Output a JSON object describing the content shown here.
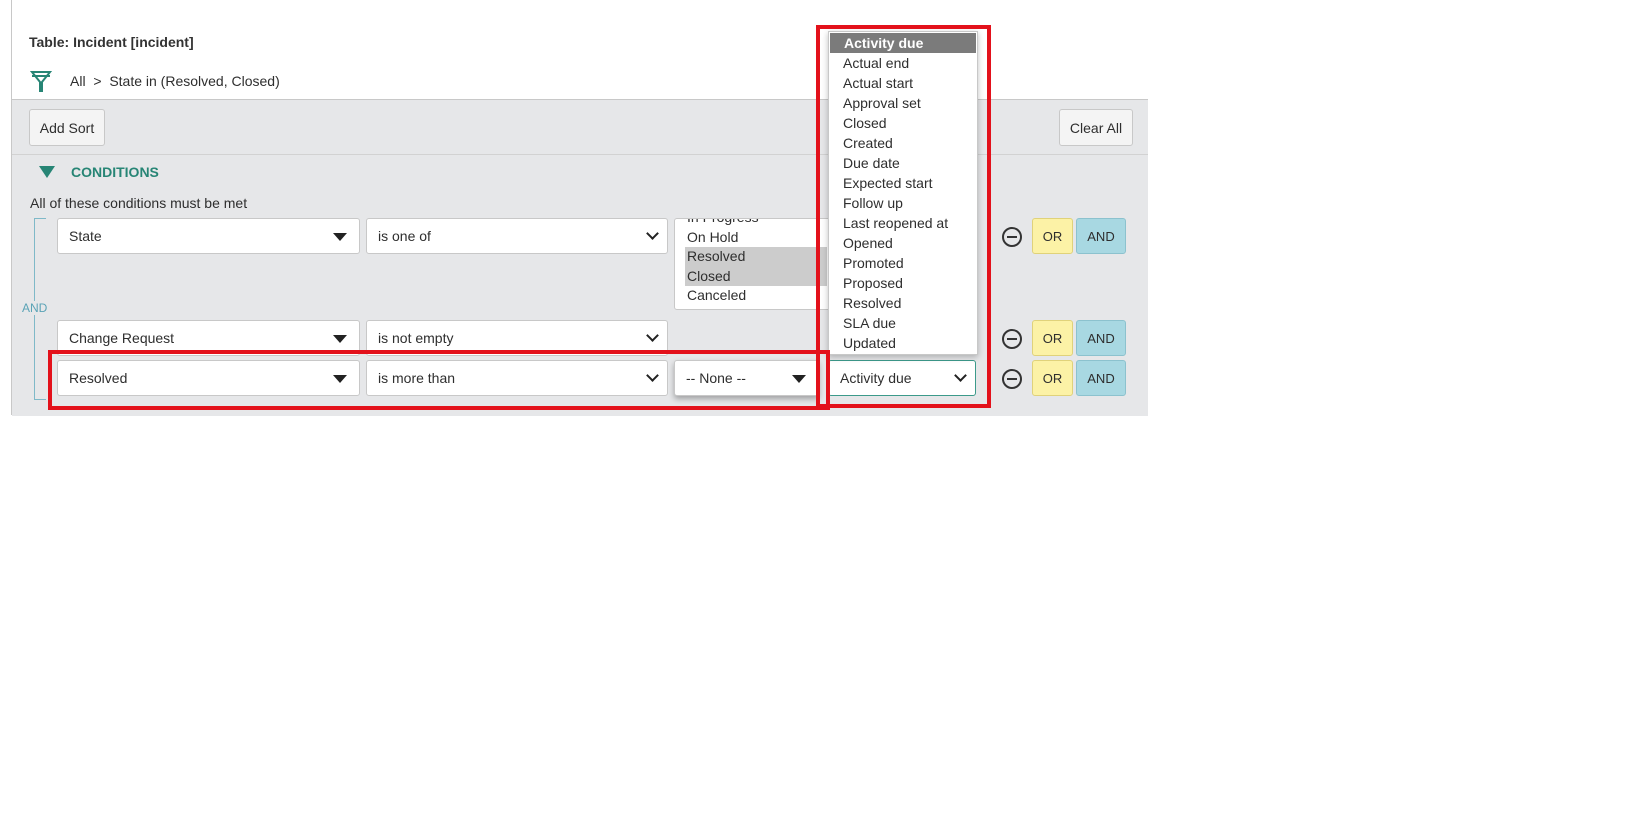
{
  "header": {
    "table_label": "Table: Incident [incident]",
    "breadcrumb_all": "All",
    "breadcrumb_sep": ">",
    "breadcrumb_filter": "State in (Resolved, Closed)"
  },
  "toolbar": {
    "add_sort": "Add Sort",
    "clear_all": "Clear All"
  },
  "conditions": {
    "heading": "CONDITIONS",
    "subtitle": "All of these conditions must be met",
    "join_label": "AND"
  },
  "rows": [
    {
      "field": "State",
      "operator": "is one of",
      "values": [
        "In Progress",
        "On Hold",
        "Resolved",
        "Closed",
        "Canceled"
      ],
      "selected_values": [
        "Resolved",
        "Closed"
      ]
    },
    {
      "field": "Change Request",
      "operator": "is not empty"
    },
    {
      "field": "Resolved",
      "operator": "is more than",
      "value": "-- None --",
      "compare_field": "Activity due"
    }
  ],
  "row_buttons": {
    "or": "OR",
    "and": "AND"
  },
  "dropdown": {
    "selected": "Activity due",
    "options": [
      "Activity due",
      "Actual end",
      "Actual start",
      "Approval set",
      "Closed",
      "Created",
      "Due date",
      "Expected start",
      "Follow up",
      "Last reopened at",
      "Opened",
      "Promoted",
      "Proposed",
      "Resolved",
      "SLA due",
      "Updated"
    ]
  },
  "colors": {
    "accent": "#278575",
    "highlight": "#e3111b",
    "or_button": "#fcf2a6",
    "and_button": "#a8d8e2"
  }
}
